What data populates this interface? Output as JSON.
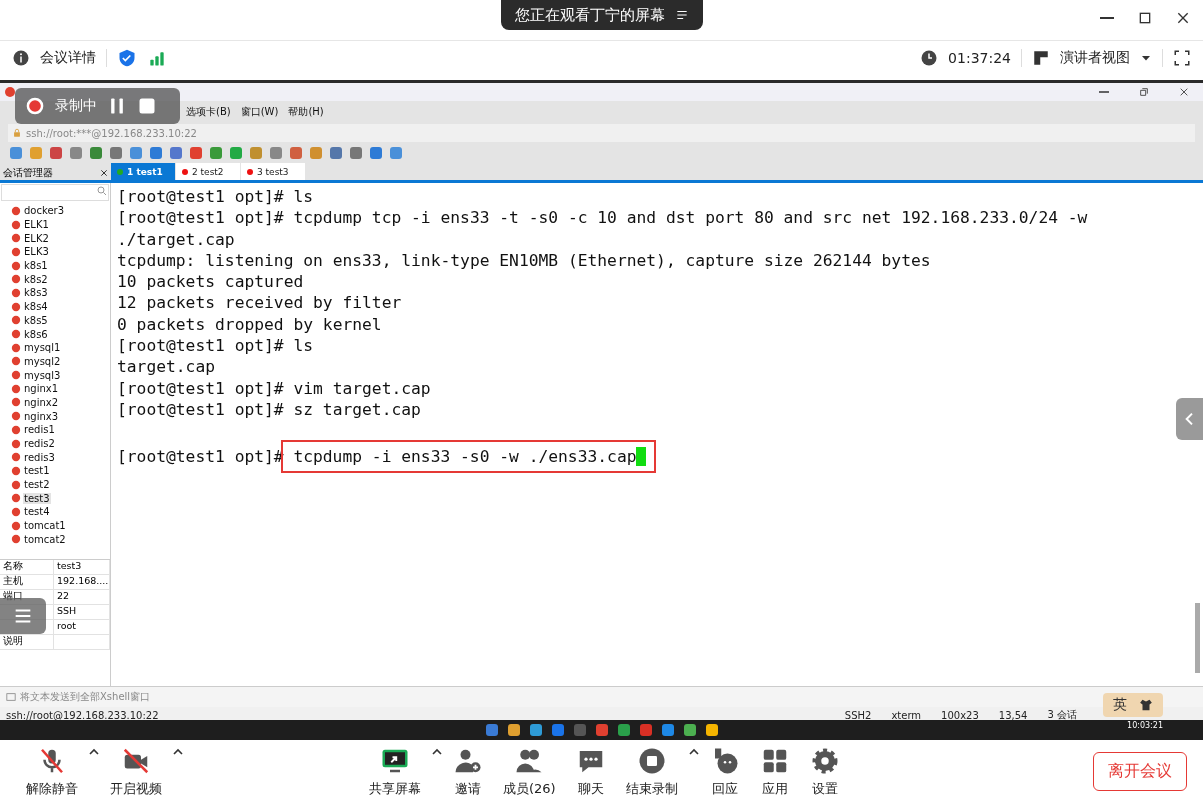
{
  "meeting": {
    "toast": "您正在观看丁宁的屏幕",
    "details": "会议详情",
    "timer": "01:37:24",
    "view": "演讲者视图"
  },
  "recording": {
    "label": "录制中"
  },
  "xshell": {
    "menu": [
      "选项卡(B)",
      "窗口(W)",
      "帮助(H)"
    ],
    "address": "ssh://root:***@192.168.233.10:22",
    "session_manager": "会话管理器",
    "tabs": [
      {
        "label": "1 test1",
        "selected": true,
        "color": "#22aa22"
      },
      {
        "label": "2 test2",
        "selected": false,
        "color": "#ee1111"
      },
      {
        "label": "3 test3",
        "selected": false,
        "color": "#ee1111"
      }
    ],
    "sessions": [
      {
        "label": "docker3",
        "selected": false
      },
      {
        "label": "ELK1",
        "selected": false
      },
      {
        "label": "ELK2",
        "selected": false
      },
      {
        "label": "ELK3",
        "selected": false
      },
      {
        "label": "k8s1",
        "selected": false
      },
      {
        "label": "k8s2",
        "selected": false
      },
      {
        "label": "k8s3",
        "selected": false
      },
      {
        "label": "k8s4",
        "selected": false
      },
      {
        "label": "k8s5",
        "selected": false
      },
      {
        "label": "k8s6",
        "selected": false
      },
      {
        "label": "mysql1",
        "selected": false
      },
      {
        "label": "mysql2",
        "selected": false
      },
      {
        "label": "mysql3",
        "selected": false
      },
      {
        "label": "nginx1",
        "selected": false
      },
      {
        "label": "nginx2",
        "selected": false
      },
      {
        "label": "nginx3",
        "selected": false
      },
      {
        "label": "redis1",
        "selected": false
      },
      {
        "label": "redis2",
        "selected": false
      },
      {
        "label": "redis3",
        "selected": false
      },
      {
        "label": "test1",
        "selected": false
      },
      {
        "label": "test2",
        "selected": false
      },
      {
        "label": "test3",
        "selected": true
      },
      {
        "label": "test4",
        "selected": false
      },
      {
        "label": "tomcat1",
        "selected": false
      },
      {
        "label": "tomcat2",
        "selected": false
      }
    ],
    "properties": [
      {
        "name": "名称",
        "value": "test3"
      },
      {
        "name": "主机",
        "value": "192.168...."
      },
      {
        "name": "端口",
        "value": "22"
      },
      {
        "value": "SSH"
      },
      {
        "value": "root"
      },
      {
        "name": "说明"
      }
    ],
    "terminal": {
      "lines": [
        "[root@test1 opt]# ls",
        "[root@test1 opt]# tcpdump tcp -i ens33 -t -s0 -c 10 and dst port 80 and src net 192.168.233.0/24 -w",
        "./target.cap",
        "tcpdump: listening on ens33, link-type EN10MB (Ethernet), capture size 262144 bytes",
        "10 packets captured",
        "12 packets received by filter",
        "0 packets dropped by kernel",
        "[root@test1 opt]# ls",
        "target.cap",
        "[root@test1 opt]# vim target.cap",
        "[root@test1 opt]# sz target.cap"
      ],
      "prompt": "[root@test1 opt]#",
      "command": "tcpdump -i ens33 -s0 -w ./ens33.cap"
    },
    "send_bar": "将文本发送到全部Xshell窗口",
    "status": {
      "address": "ssh://root@192.168.233.10:22",
      "protocol": "SSH2",
      "term": "xterm",
      "size": "100x23",
      "cursor": "13,54",
      "sessions": "3 会话"
    }
  },
  "taskbar": {
    "clock": "10:03:21"
  },
  "ime": {
    "label": "英"
  },
  "toolbar": [
    {
      "label": "解除静音",
      "kind": "mic"
    },
    {
      "label": "开启视频",
      "kind": "video"
    },
    {
      "label": "共享屏幕",
      "kind": "share"
    },
    {
      "label": "邀请",
      "kind": "invite"
    },
    {
      "label": "成员(26)",
      "kind": "members"
    },
    {
      "label": "聊天",
      "kind": "chat"
    },
    {
      "label": "结束录制",
      "kind": "record"
    },
    {
      "label": "回应",
      "kind": "react"
    },
    {
      "label": "应用",
      "kind": "apps"
    },
    {
      "label": "设置",
      "kind": "settings"
    }
  ],
  "leave": "离开会议"
}
